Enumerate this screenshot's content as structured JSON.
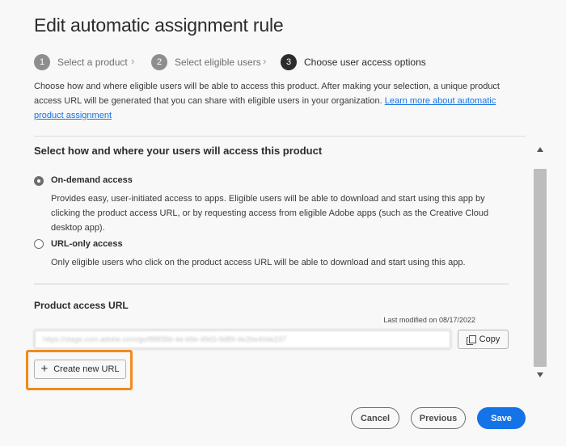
{
  "dialog": {
    "title": "Edit automatic assignment rule"
  },
  "steps": [
    {
      "num": "1",
      "label": "Select a product"
    },
    {
      "num": "2",
      "label": "Select eligible users"
    },
    {
      "num": "3",
      "label": "Choose user access options"
    }
  ],
  "description": {
    "text": "Choose how and where eligible users will be able to access this product. After making your selection, a unique product access URL will be generated that you can share with eligible users in your organization.",
    "link_text": "Learn more about automatic product assignment"
  },
  "access": {
    "heading": "Select how and where your users will access this product",
    "options": [
      {
        "label": "On-demand access",
        "description": "Provides easy, user-initiated access to apps. Eligible users will be able to download and start using this app by clicking the product access URL, or by requesting access from eligible Adobe apps (such as the Creative Cloud desktop app).",
        "selected": true
      },
      {
        "label": "URL-only access",
        "description": "Only eligible users who click on the product access URL will be able to download and start using this app.",
        "selected": false
      }
    ]
  },
  "product_url": {
    "heading": "Product access URL",
    "last_modified": "Last modified on 08/17/2022",
    "value": "https://stage.com.adobe.com/go/8f9f35b-4e-b9e-49d3-9d89-4e2be40de237",
    "copy_label": "Copy",
    "create_label": "Create new URL"
  },
  "footer": {
    "cancel_label": "Cancel",
    "previous_label": "Previous",
    "save_label": "Save"
  },
  "colors": {
    "accent": "#1473e6",
    "highlight": "#f28a1e"
  }
}
